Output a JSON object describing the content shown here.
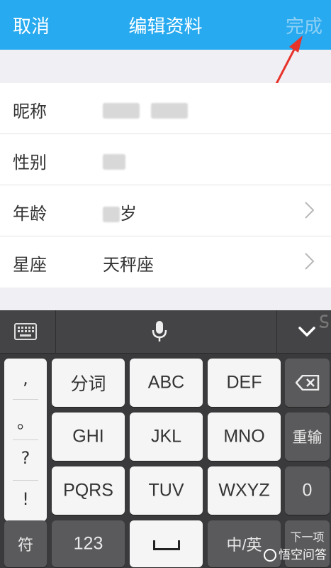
{
  "header": {
    "cancel": "取消",
    "title": "编辑资料",
    "done": "完成"
  },
  "form": {
    "rows": [
      {
        "label": "昵称",
        "value": ""
      },
      {
        "label": "性别",
        "value": ""
      },
      {
        "label": "年龄",
        "value": "岁"
      },
      {
        "label": "星座",
        "value": "天秤座"
      }
    ]
  },
  "keyboard": {
    "punct": [
      ",",
      "。",
      "?",
      "!"
    ],
    "keys": {
      "fenci": "分词",
      "abc": "ABC",
      "def": "DEF",
      "del": "⌫",
      "ghi": "GHI",
      "jkl": "JKL",
      "mno": "MNO",
      "retype": "重输",
      "pqrs": "PQRS",
      "tuv": "TUV",
      "wxyz": "WXYZ",
      "zero": "0",
      "symbol": "符",
      "num": "123",
      "lang": "中/英",
      "next": "下一项"
    }
  },
  "watermark": "悟空问答",
  "colors": {
    "header": "#27aaf0",
    "annotation": "#e8332b"
  }
}
